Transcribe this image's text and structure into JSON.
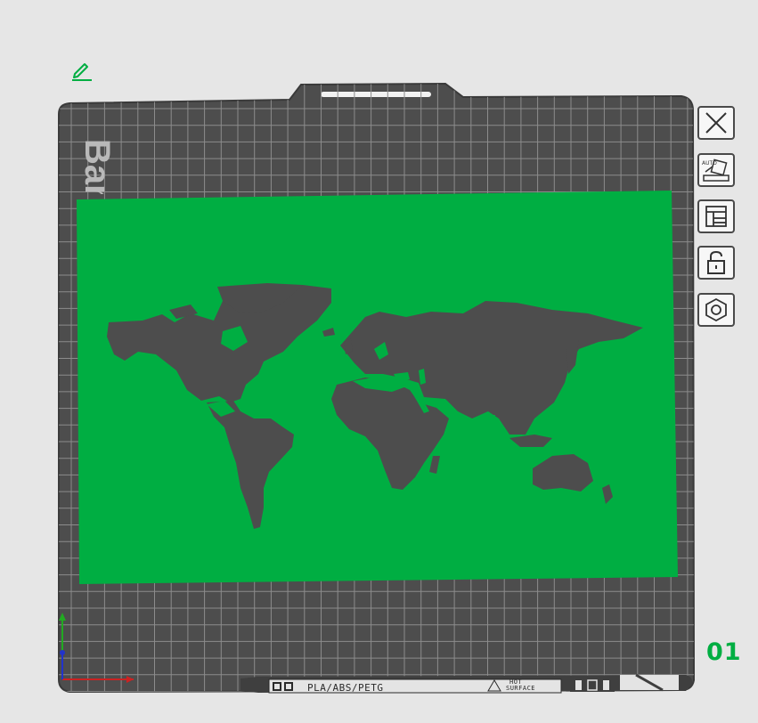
{
  "plate": {
    "brand": "Bam",
    "number": "01",
    "surface_label": "PLA/ABS/PETG",
    "hot_line1": "HOT",
    "hot_line2": "SURFACE"
  },
  "model": {
    "name": "world-map-plaque",
    "color": "#00ae42"
  },
  "toolbar": {
    "buttons": [
      {
        "name": "close-plate",
        "icon": "close-icon"
      },
      {
        "name": "auto-orient",
        "icon": "auto-orient-icon",
        "text": "AUTO"
      },
      {
        "name": "arrange",
        "icon": "arrange-icon"
      },
      {
        "name": "lock-plate",
        "icon": "unlock-icon"
      },
      {
        "name": "plate-settings",
        "icon": "hexagon-settings-icon"
      }
    ]
  },
  "colors": {
    "accent": "#00ae42",
    "plate_bg": "#4d4d4d",
    "grid": "#8c8c8c",
    "background": "#e6e6e6",
    "axis_x": "#cc2222",
    "axis_y": "#22aa22",
    "axis_z": "#2233cc"
  }
}
